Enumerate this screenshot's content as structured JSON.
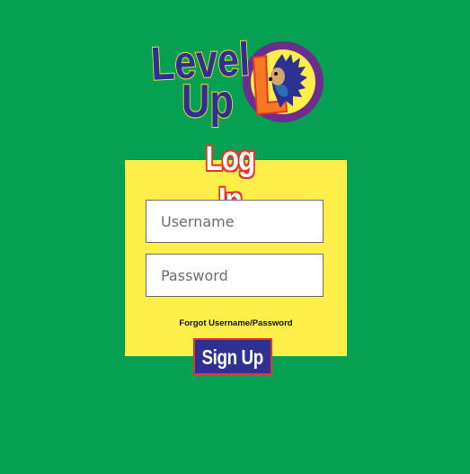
{
  "logo": {
    "line1": "Level",
    "line2": "Up",
    "badge_letter": "L",
    "colors": {
      "text": "#2e3192",
      "text_outline": "#f7e232",
      "badge_ring": "#6b2d8e",
      "badge_fill": "#fdee4a",
      "badge_letter": "#f47920",
      "mascot": "#2e3192"
    }
  },
  "login": {
    "title": "Log In",
    "username_placeholder": "Username",
    "password_placeholder": "Password",
    "forgot_label": "Forgot Username/Password",
    "signup_label": "Sign Up"
  },
  "colors": {
    "background": "#05a052",
    "card": "#fdee4a",
    "signup_button": "#2e3192",
    "title_outline": "#e5362b"
  }
}
